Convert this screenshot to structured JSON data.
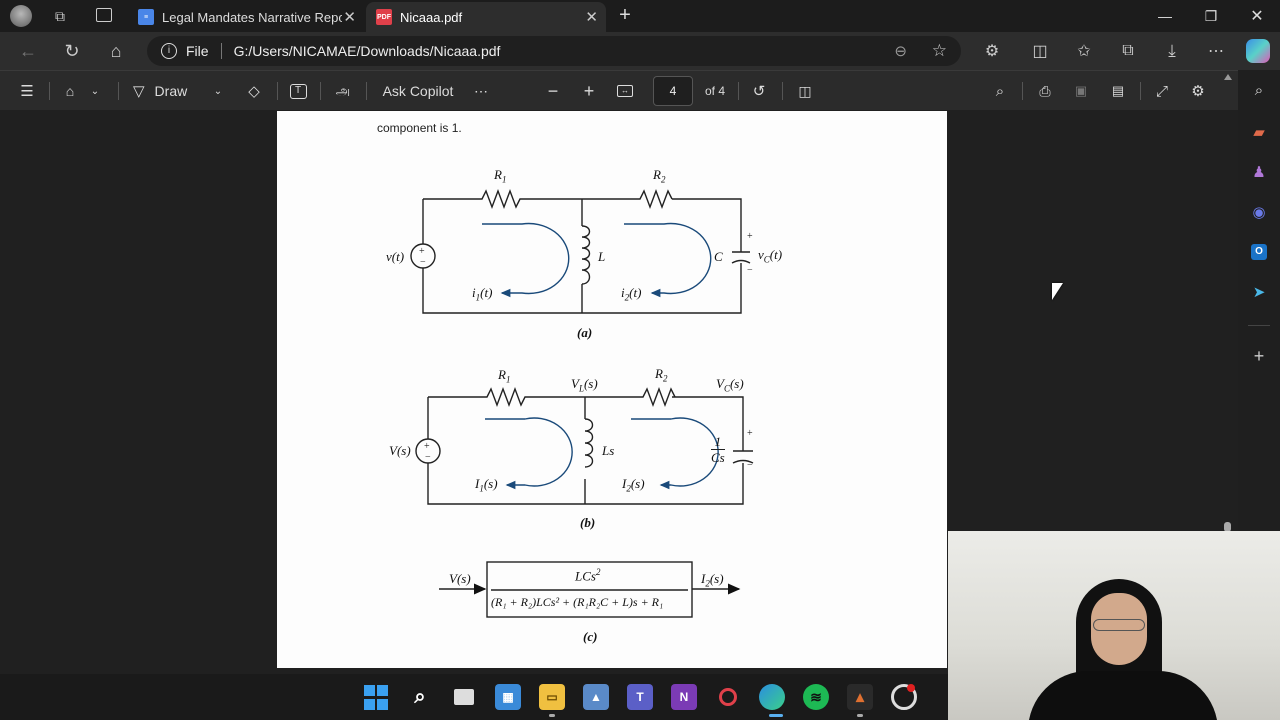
{
  "browser": {
    "tabs": [
      {
        "title": "Legal Mandates Narrative Report",
        "icon": "docs-icon",
        "active": false
      },
      {
        "title": "Nicaaa.pdf",
        "icon": "pdf-icon",
        "active": true
      }
    ],
    "address": {
      "scheme_label": "File",
      "url": "G:/Users/NICAMAE/Downloads/Nicaaa.pdf"
    }
  },
  "pdf_toolbar": {
    "draw_label": "Draw",
    "ask_copilot_label": "Ask Copilot",
    "read_aloud_glyph": "அ",
    "current_page": "4",
    "page_total": "of 4"
  },
  "document": {
    "intro_text": "component is 1.",
    "figure_a": {
      "caption": "(a)",
      "labels": {
        "r1": "R",
        "r1_sub": "1",
        "r2": "R",
        "r2_sub": "2",
        "source": "v(t)",
        "inductor": "L",
        "capacitor": "C",
        "vc": "v",
        "vc_sub": "C",
        "vc_arg": "(t)",
        "i1": "i",
        "i1_sub": "1",
        "i1_arg": "(t)",
        "i2": "i",
        "i2_sub": "2",
        "i2_arg": "(t)"
      }
    },
    "figure_b": {
      "caption": "(b)",
      "labels": {
        "r1": "R",
        "r1_sub": "1",
        "r2": "R",
        "r2_sub": "2",
        "vl": "V",
        "vl_sub": "L",
        "vl_arg": "(s)",
        "vc": "V",
        "vc_sub": "C",
        "vc_arg": "(s)",
        "source": "V(s)",
        "inductor": "Ls",
        "cap_num": "1",
        "cap_den": "Cs",
        "i1": "I",
        "i1_sub": "1",
        "i1_arg": "(s)",
        "i2": "I",
        "i2_sub": "2",
        "i2_arg": "(s)"
      }
    },
    "figure_c": {
      "caption": "(c)",
      "input": "V(s)",
      "output_main": "I",
      "output_sub": "2",
      "output_arg": "(s)",
      "numerator": "LCs",
      "numerator_exp": "2",
      "denominator": "(R₁ + R₂)LCs² + (R₁R₂C + L)s + R₁"
    }
  },
  "colors": {
    "accent_blue": "#2b579a",
    "arrow_blue": "#1a5a8a",
    "edge_copilot": "#3a8ee6"
  }
}
